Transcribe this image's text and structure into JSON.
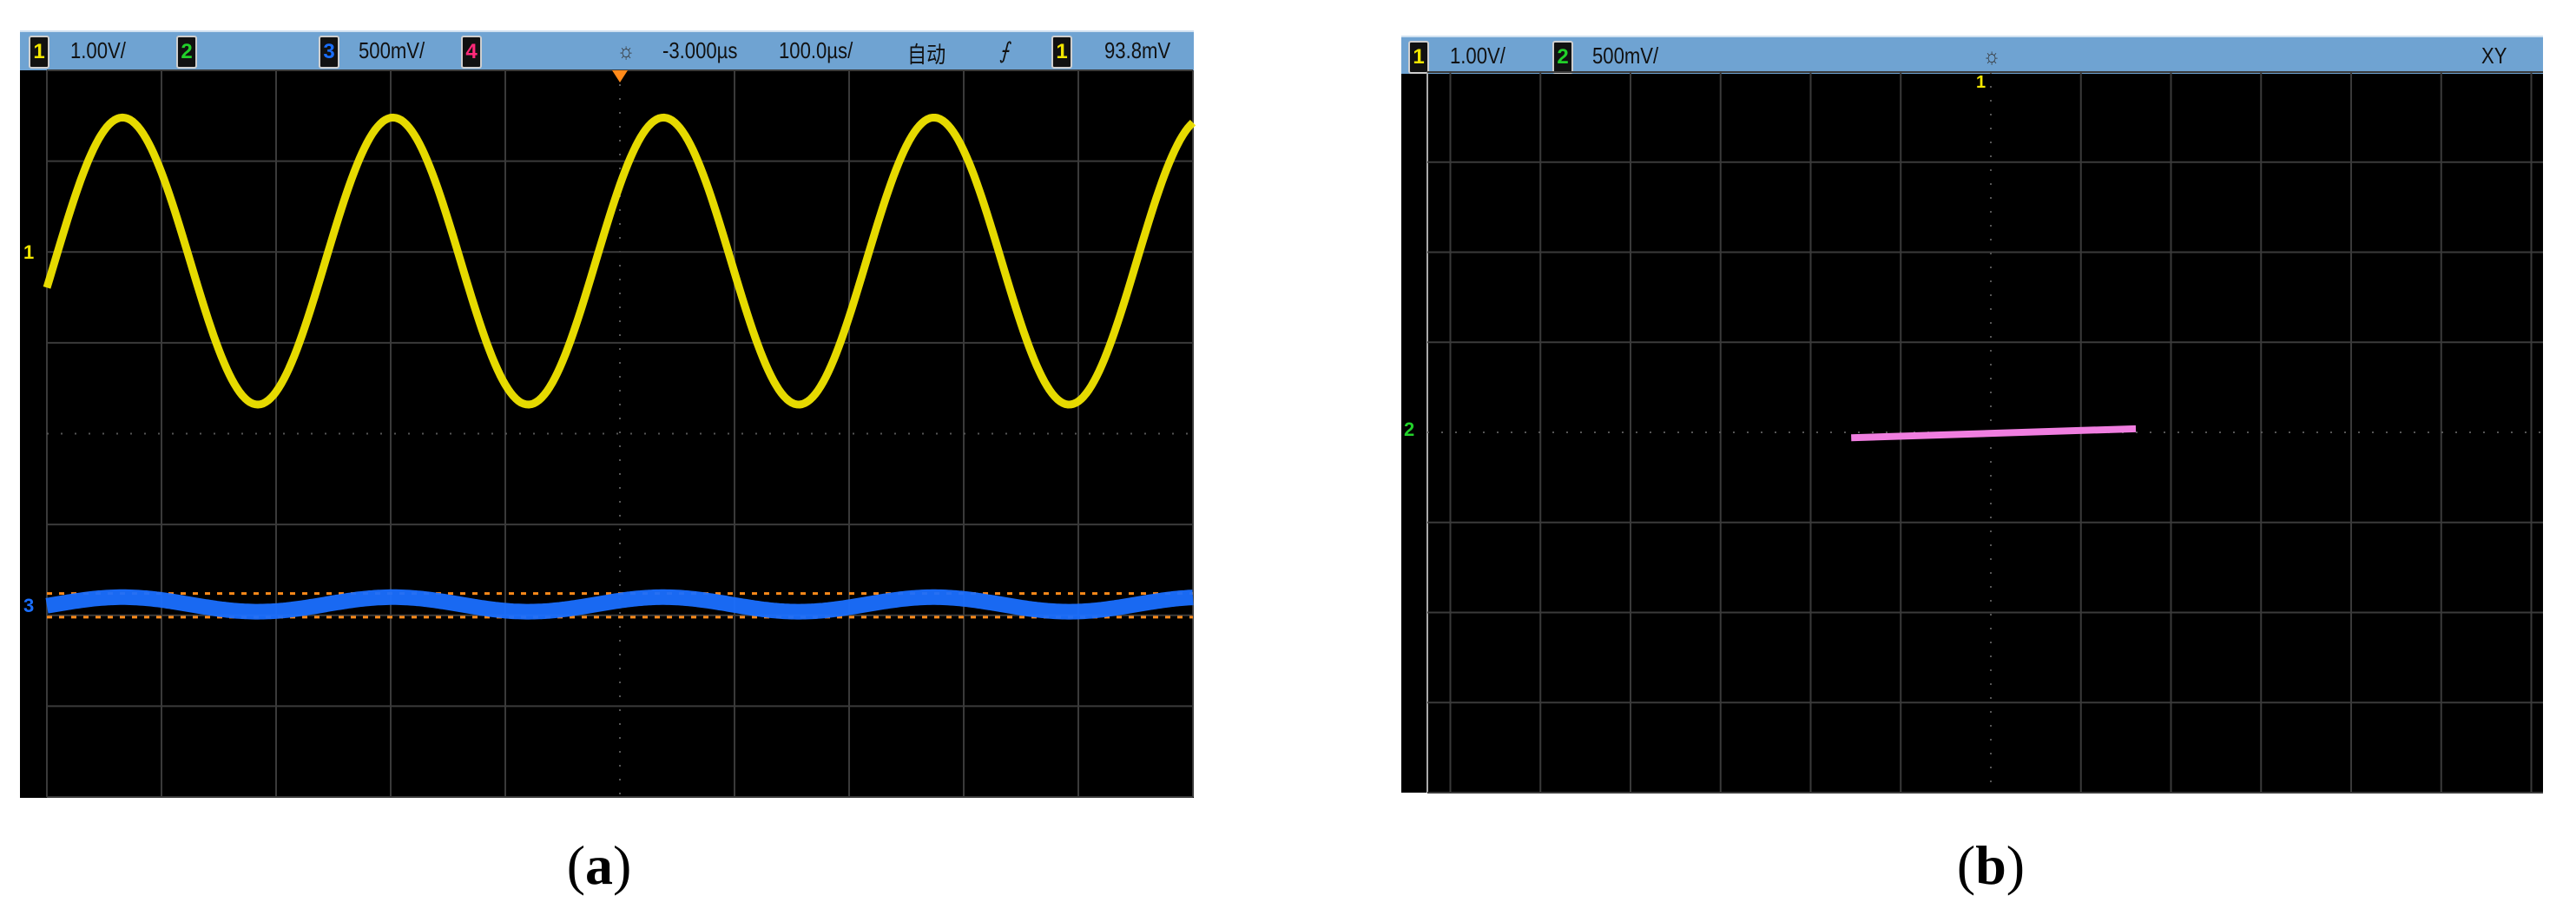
{
  "panel_a": {
    "header": {
      "ch1_num": "1",
      "ch1_scale": "1.00V/",
      "ch2_num": "2",
      "ch3_num": "3",
      "ch3_scale": "500mV/",
      "ch4_num": "4",
      "time_offset": "-3.000µs",
      "time_scale": "100.0µs/",
      "trigger_mode": "自动",
      "trigger_slope": "⨍",
      "trigger_src": "1",
      "trigger_level": "93.8mV"
    },
    "markers": {
      "ch1": "1",
      "ch3": "3"
    },
    "caption_open": "(",
    "caption_letter": "a",
    "caption_close": ")"
  },
  "panel_b": {
    "header": {
      "ch1_num": "1",
      "ch1_scale": "1.00V/",
      "ch2_num": "2",
      "ch2_scale": "500mV/",
      "mode": "XY"
    },
    "markers": {
      "ch1": "1",
      "ch2": "2"
    },
    "caption_open": "(",
    "caption_letter": "b",
    "caption_close": ")"
  },
  "colors": {
    "ch1": "#f2e600",
    "ch2": "#22d12a",
    "ch3": "#1a6fff",
    "ch4": "#ff2a7a",
    "xy": "#f07ee0",
    "header": "#6fa3d2",
    "trigger": "#ff8a1a"
  },
  "chart_data": [
    {
      "type": "line",
      "title": "(a) Time-domain: CH1 and CH3",
      "x_unit": "µs",
      "time_per_div": 100,
      "divisions_x": 10,
      "divisions_y": 8,
      "series": [
        {
          "name": "CH1",
          "volts_per_div": 1.0,
          "waveform": "sine",
          "amplitude_v": 1.58,
          "period_us": 236,
          "peak_time_us": -434,
          "offset_div": 1.9,
          "color": "#f2e600"
        },
        {
          "name": "CH3",
          "volts_per_div": 0.5,
          "waveform": "sine",
          "amplitude_v": 0.04,
          "period_us": 236,
          "peak_time_us": -434,
          "offset_div": -1.88,
          "color": "#1a6fff"
        }
      ],
      "cursor_levels_div": [
        -1.76,
        -2.02
      ]
    },
    {
      "type": "line",
      "title": "(b) XY mode: CH1 (X) vs CH2 (Y)",
      "x_volts_per_div": 1.0,
      "y_volts_per_div": 0.5,
      "series": [
        {
          "name": "XY",
          "x": [
            -1.55,
            1.61
          ],
          "y": [
            -0.03,
            0.02
          ],
          "color": "#f07ee0"
        }
      ]
    }
  ]
}
